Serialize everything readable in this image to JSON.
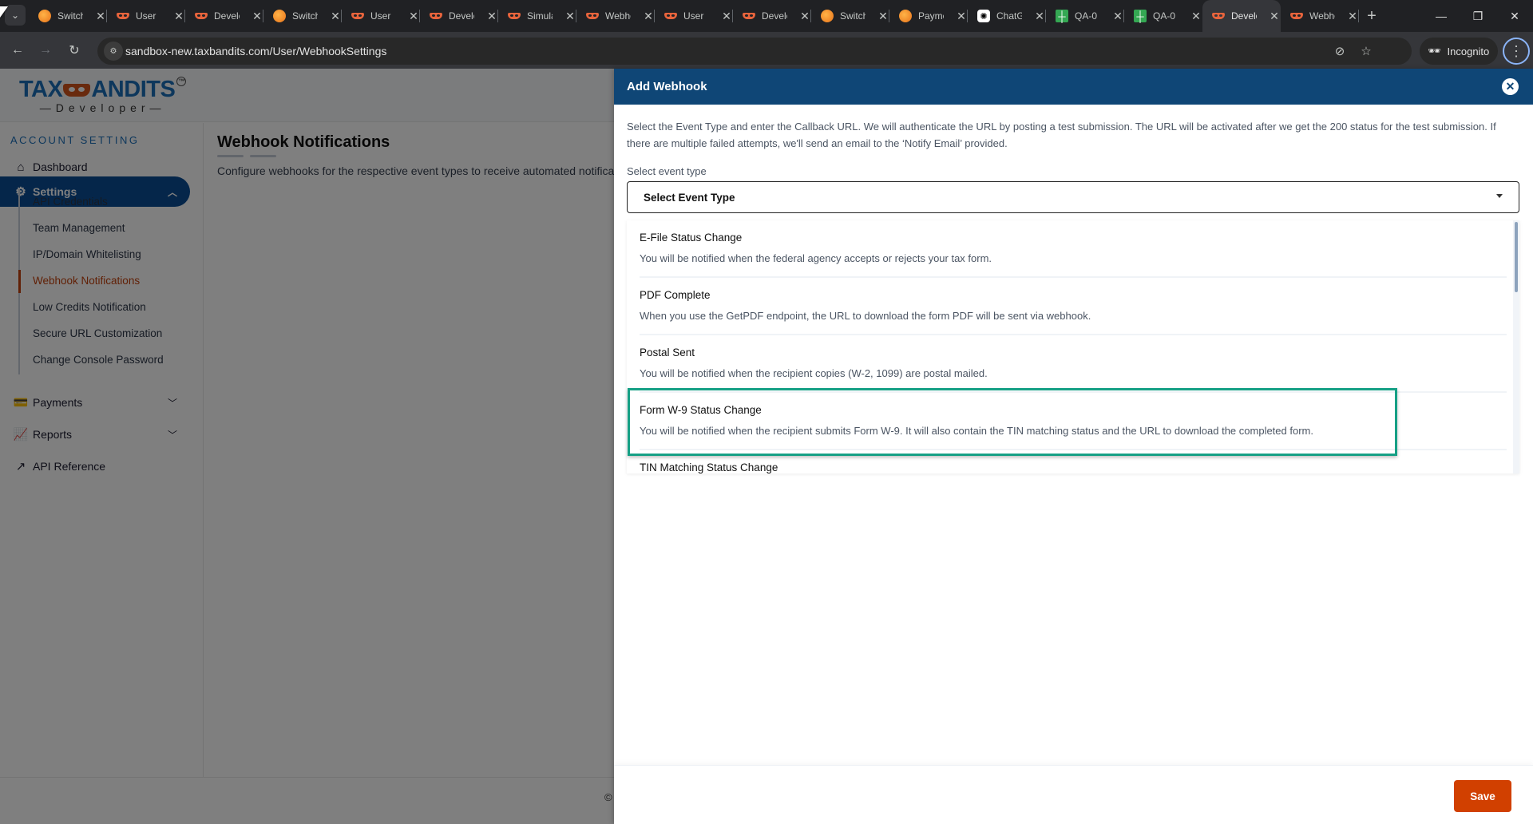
{
  "browser": {
    "tabs": [
      {
        "title": "Switch",
        "favicon": "orange-bandit-icon"
      },
      {
        "title": "User",
        "favicon": "taxbandits-mask-icon"
      },
      {
        "title": "Developer",
        "favicon": "taxbandits-mask-icon"
      },
      {
        "title": "Switch",
        "favicon": "orange-bandit-icon"
      },
      {
        "title": "User",
        "favicon": "taxbandits-mask-icon"
      },
      {
        "title": "Developer",
        "favicon": "taxbandits-mask-icon"
      },
      {
        "title": "Simulate",
        "favicon": "taxbandits-mask-icon"
      },
      {
        "title": "Webhook",
        "favicon": "taxbandits-mask-icon"
      },
      {
        "title": "User",
        "favicon": "taxbandits-mask-icon"
      },
      {
        "title": "Developer",
        "favicon": "taxbandits-mask-icon"
      },
      {
        "title": "Switch",
        "favicon": "orange-bandit-icon"
      },
      {
        "title": "Payment",
        "favicon": "orange-bandit-icon"
      },
      {
        "title": "ChatGPT",
        "favicon": "chatgpt-icon"
      },
      {
        "title": "QA-0",
        "favicon": "google-sheets-icon"
      },
      {
        "title": "QA-0",
        "favicon": "google-sheets-icon"
      },
      {
        "title": "Developer",
        "favicon": "taxbandits-mask-icon",
        "active": true
      },
      {
        "title": "Webhook",
        "favicon": "taxbandits-mask-icon"
      }
    ],
    "url": "sandbox-new.taxbandits.com/User/WebhookSettings",
    "incognito_label": "Incognito"
  },
  "app": {
    "logo_main_left": "TAX",
    "logo_main_right": "ANDITS",
    "logo_tm": "TM",
    "logo_sub": "—Developer—",
    "sidebar": {
      "heading": "ACCOUNT SETTING",
      "dashboard": "Dashboard",
      "settings": "Settings",
      "settings_sub": [
        "API Credentials",
        "Team Management",
        "IP/Domain Whitelisting",
        "Webhook Notifications",
        "Low Credits Notification",
        "Secure URL Customization",
        "Change Console Password"
      ],
      "active_sub": "Webhook Notifications",
      "payments": "Payments",
      "reports": "Reports",
      "api_reference": "API Reference"
    },
    "main": {
      "title": "Webhook Notifications",
      "description": "Configure webhooks for the respective event types to receive automated notifica"
    },
    "footer_copyright": "©"
  },
  "modal": {
    "title": "Add Webhook",
    "intro": "Select the Event Type and enter the Callback URL. We will authenticate the URL by posting a test submission. The URL will be activated after we get the 200 status for the test submission. If there are multiple failed attempts, we'll send an email to the ‘Notify Email’ provided.",
    "event_label": "Select event type",
    "event_select_value": "Select Event Type",
    "options": [
      {
        "title": "E-File Status Change",
        "desc": "You will be notified when the federal agency accepts or rejects your tax form."
      },
      {
        "title": "PDF Complete",
        "desc": "When you use the GetPDF endpoint, the URL to download the form PDF will be sent via webhook."
      },
      {
        "title": "Postal Sent",
        "desc": "You will be notified when the recipient copies (W-2, 1099) are postal mailed."
      },
      {
        "title": "Form W-9 Status Change",
        "desc": "You will be notified when the recipient submits Form W-9. It will also contain the TIN matching status and the URL to download the completed form.",
        "highlighted": true
      },
      {
        "title": "TIN Matching Status Change",
        "desc": ""
      }
    ],
    "save_label": "Save",
    "highlight_color": "#16a085",
    "header_color": "#0f4676",
    "save_color": "#d14000"
  }
}
